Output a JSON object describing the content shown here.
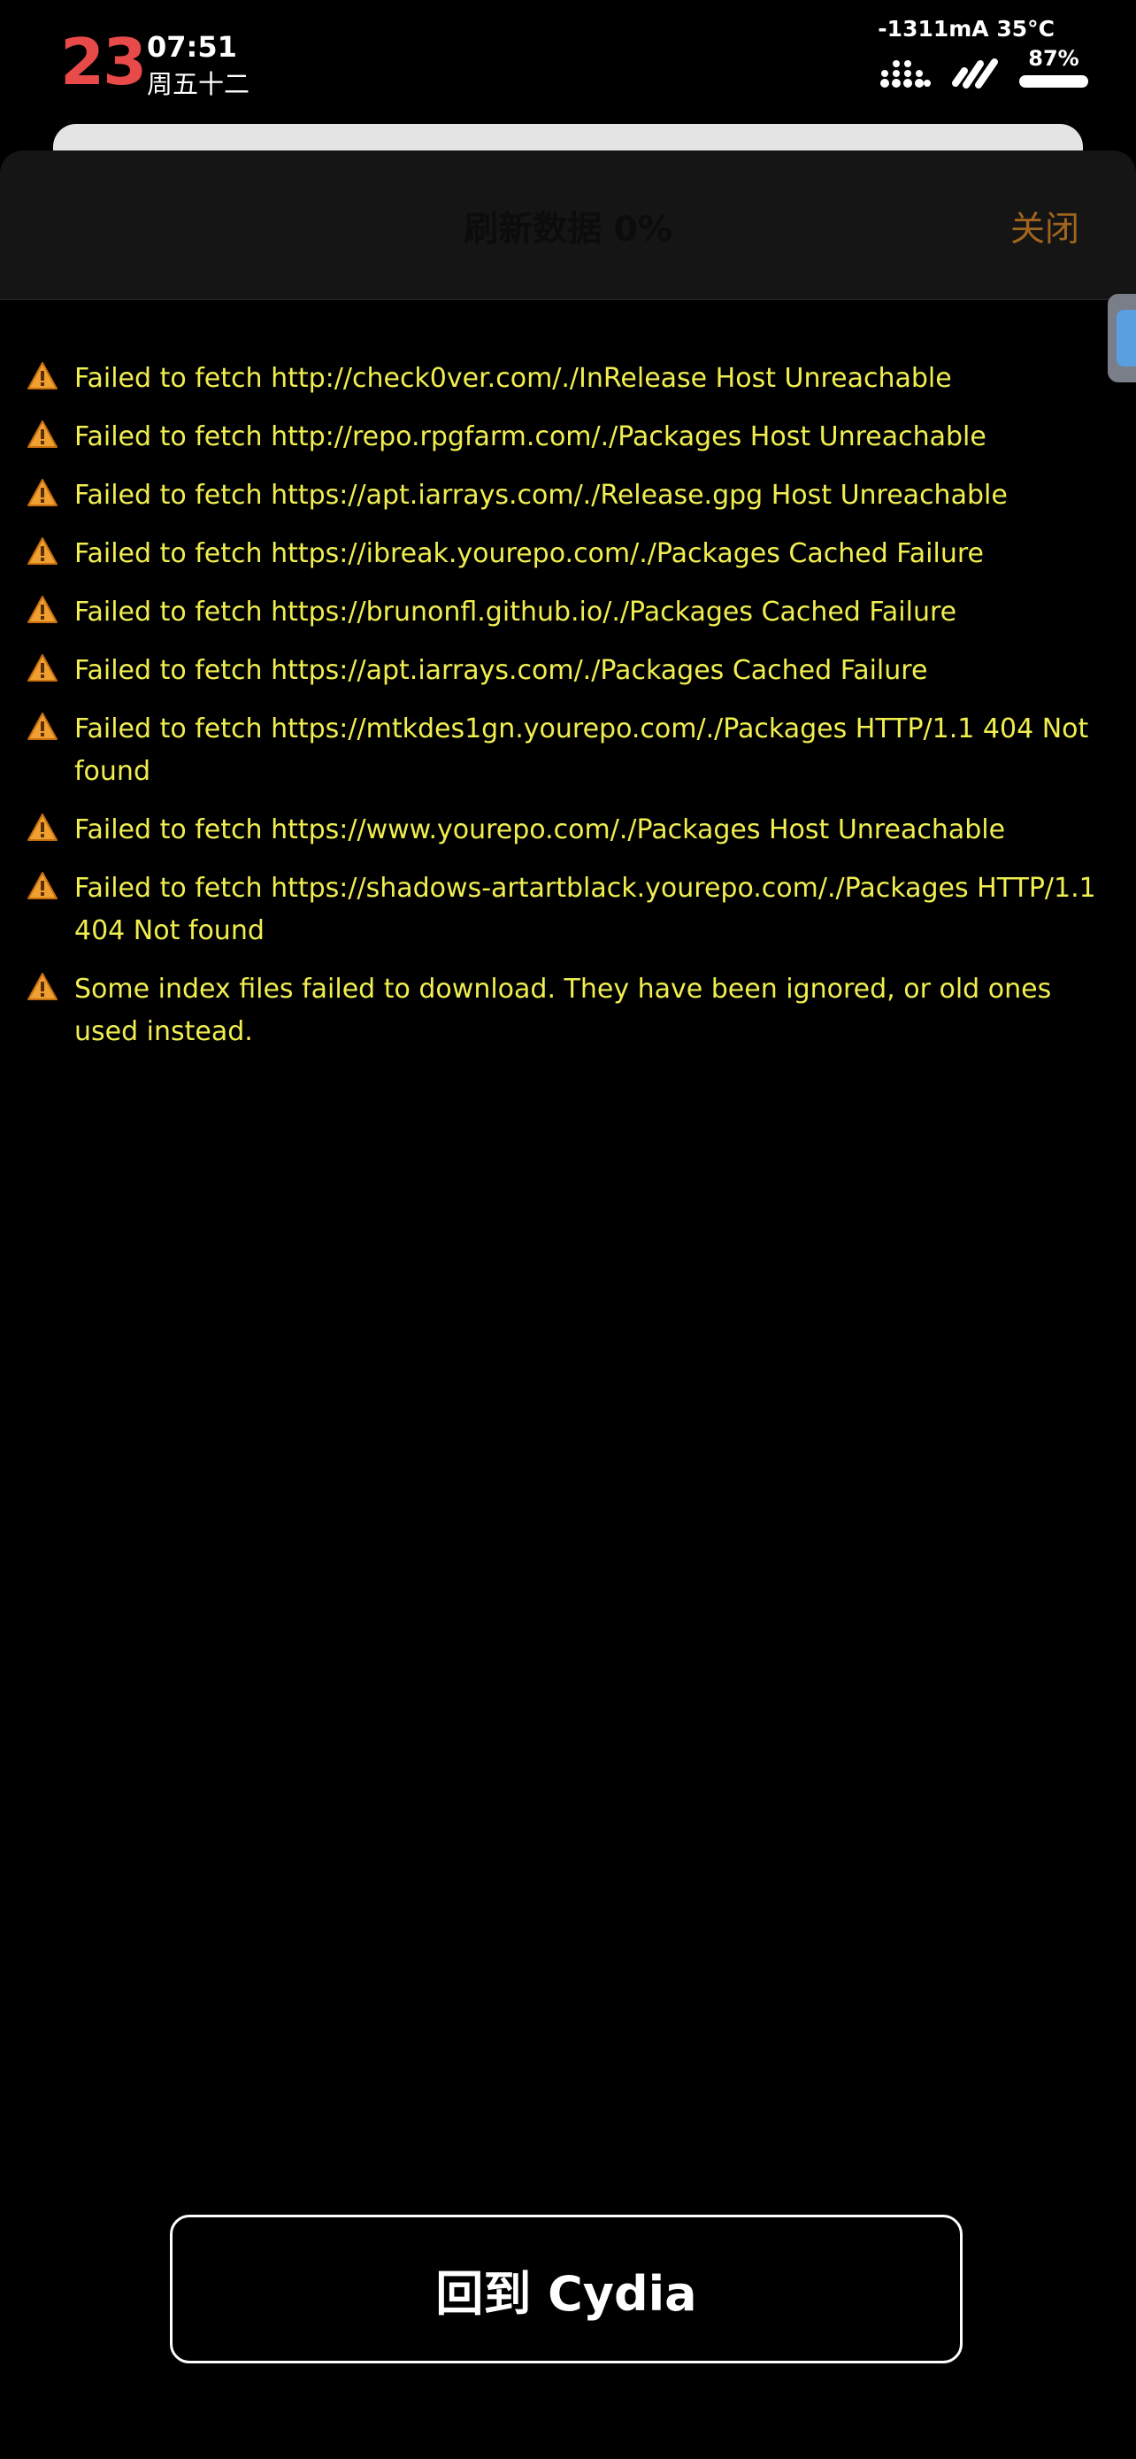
{
  "status_bar": {
    "day": "23",
    "time": "07:51",
    "weekday": "周五十二",
    "sysinfo": "-1311mA 35°C",
    "battery": "87%"
  },
  "nav": {
    "title": "刷新数据 0%",
    "close_label": "关闭"
  },
  "log": [
    "Failed to fetch http://check0ver.com/./InRelease Host Unreachable",
    "Failed to fetch http://repo.rpgfarm.com/./Packages Host Unreachable",
    "Failed to fetch https://apt.iarrays.com/./Release.gpg Host Unreachable",
    "Failed to fetch https://ibreak.yourepo.com/./Packages Cached Failure",
    "Failed to fetch https://brunonfl.github.io/./Packages Cached Failure",
    "Failed to fetch https://apt.iarrays.com/./Packages Cached Failure",
    "Failed to fetch https://mtkdes1gn.yourepo.com/./Packages HTTP/1.1 404 Not found",
    "Failed to fetch https://www.yourepo.com/./Packages Host Unreachable",
    "Failed to fetch https://shadows-artartblack.yourepo.com/./Packages HTTP/1.1 404 Not found",
    "Some index files failed to download. They have been ignored, or old ones used instead."
  ],
  "button": {
    "return_label": "回到 Cydia"
  },
  "colors": {
    "day": "#e84a4a",
    "log_text": "#f0ee50",
    "close": "#a0641d",
    "warning_icon": "#f0a030"
  },
  "icons": [
    "signal-icon",
    "wifi-icon",
    "battery-icon",
    "warning-icon"
  ]
}
